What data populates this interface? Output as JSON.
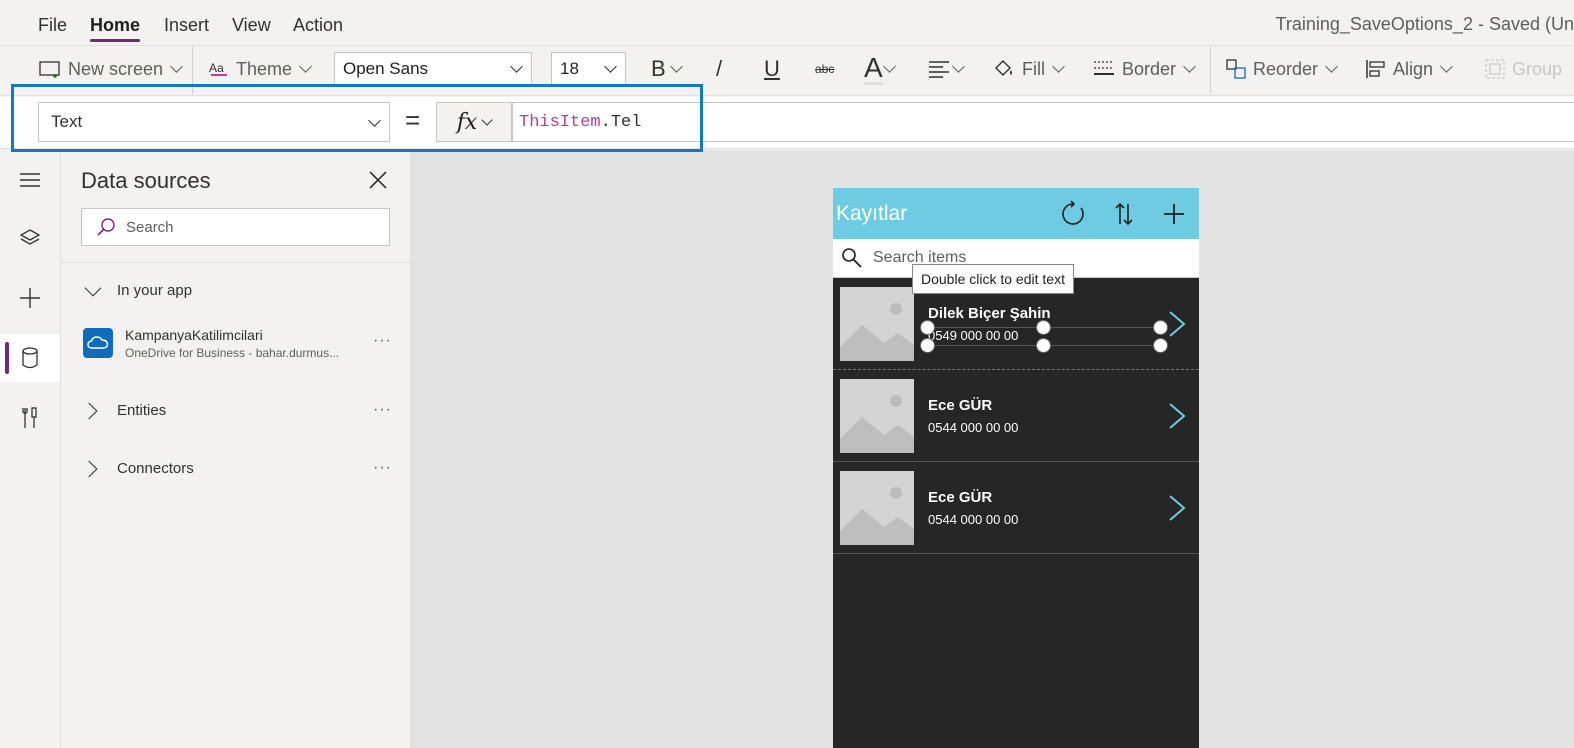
{
  "title_bar": {
    "app_title": "Training_SaveOptions_2 - Saved (Un"
  },
  "menu": {
    "items": [
      {
        "label": "File"
      },
      {
        "label": "Home",
        "active": true
      },
      {
        "label": "Insert"
      },
      {
        "label": "View"
      },
      {
        "label": "Action"
      }
    ]
  },
  "ribbon": {
    "new_screen": "New screen",
    "theme": "Theme",
    "font_family": "Open Sans",
    "font_size": "18",
    "bold": "B",
    "italic": "/",
    "underline": "U",
    "strike": "abc",
    "font_color": "A",
    "fill": "Fill",
    "border": "Border",
    "reorder": "Reorder",
    "align": "Align",
    "group": "Group"
  },
  "formula_bar": {
    "property": "Text",
    "equals": "=",
    "fx": "fx",
    "formula_keyword": "ThisItem",
    "formula_rest": ".Tel"
  },
  "data_sources_panel": {
    "title": "Data sources",
    "search_placeholder": "Search",
    "in_your_app": "In your app",
    "source_name": "KampanyaKatilimcilari",
    "source_sub": "OneDrive for Business - bahar.durmus...",
    "entities": "Entities",
    "connectors": "Connectors",
    "more": "···"
  },
  "app_preview": {
    "header_title": "Kayıtlar",
    "search_placeholder": "Search items",
    "tooltip": "Double click to edit text",
    "rows": [
      {
        "name": "Dilek Biçer Şahin",
        "tel": "0549 000 00 00"
      },
      {
        "name": "Ece GÜR",
        "tel": "0544 000 00 00"
      },
      {
        "name": "Ece GÜR",
        "tel": "0544 000 00 00"
      }
    ]
  },
  "colors": {
    "accent_purple": "#742774",
    "highlight_blue": "#0f7bc2",
    "app_header": "#6ecbe2",
    "formula_keyword": "#b43e98"
  }
}
